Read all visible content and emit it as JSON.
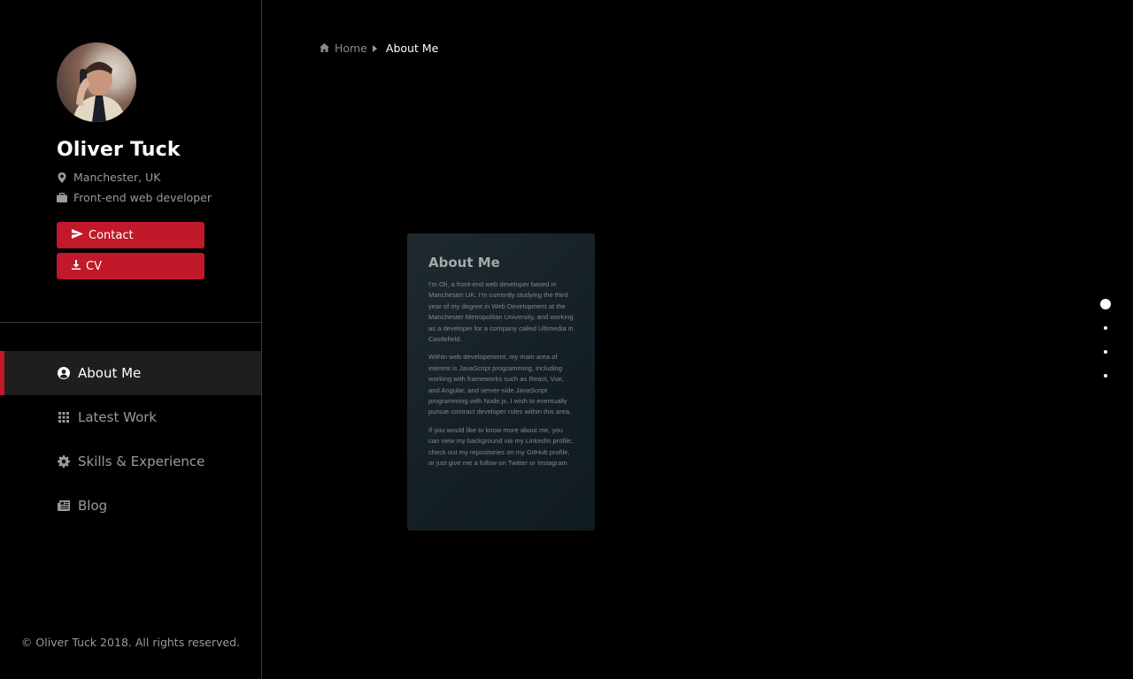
{
  "profile": {
    "name": "Oliver Tuck",
    "location": "Manchester, UK",
    "role": "Front-end web developer",
    "location_icon": "map-pin-icon",
    "role_icon": "briefcase-icon"
  },
  "actions": {
    "contact_label": "Contact",
    "cv_label": "CV"
  },
  "nav": {
    "items": [
      {
        "label": "About Me",
        "icon": "user-circle-icon",
        "active": true
      },
      {
        "label": "Latest Work",
        "icon": "grid-icon",
        "active": false
      },
      {
        "label": "Skills & Experience",
        "icon": "gear-icon",
        "active": false
      },
      {
        "label": "Blog",
        "icon": "newspaper-icon",
        "active": false
      }
    ]
  },
  "footer": {
    "copyright": "© Oliver Tuck 2018. All rights reserved."
  },
  "breadcrumb": {
    "home": "Home",
    "current": "About Me"
  },
  "about": {
    "title": "About Me",
    "paragraphs": [
      "I'm Oli, a front-end web developer based in Manchester UK. I'm currently studying the third year of my degree in Web Development at the Manchester Metropolitan University, and working as a developer for a company called Ultimedia in Castlefield.",
      "Within web developement, my main area of interest is JavaScript programming, including working with frameworks such as React, Vue, and Angular, and server-side JavaScript programming with Node.js. I wish to eventually pursue contract developer roles within this area.",
      "If you would like to know more about me, you can view my background via my LinkedIn profile, check out my repositories on my GitHub profile, or just give me a follow on Twitter or Instagram."
    ]
  },
  "pager": {
    "count": 4,
    "active_index": 0
  },
  "colors": {
    "accent": "#c1182a",
    "background": "#000000",
    "card": "#1a252b",
    "muted_text": "#9a9a9a"
  }
}
